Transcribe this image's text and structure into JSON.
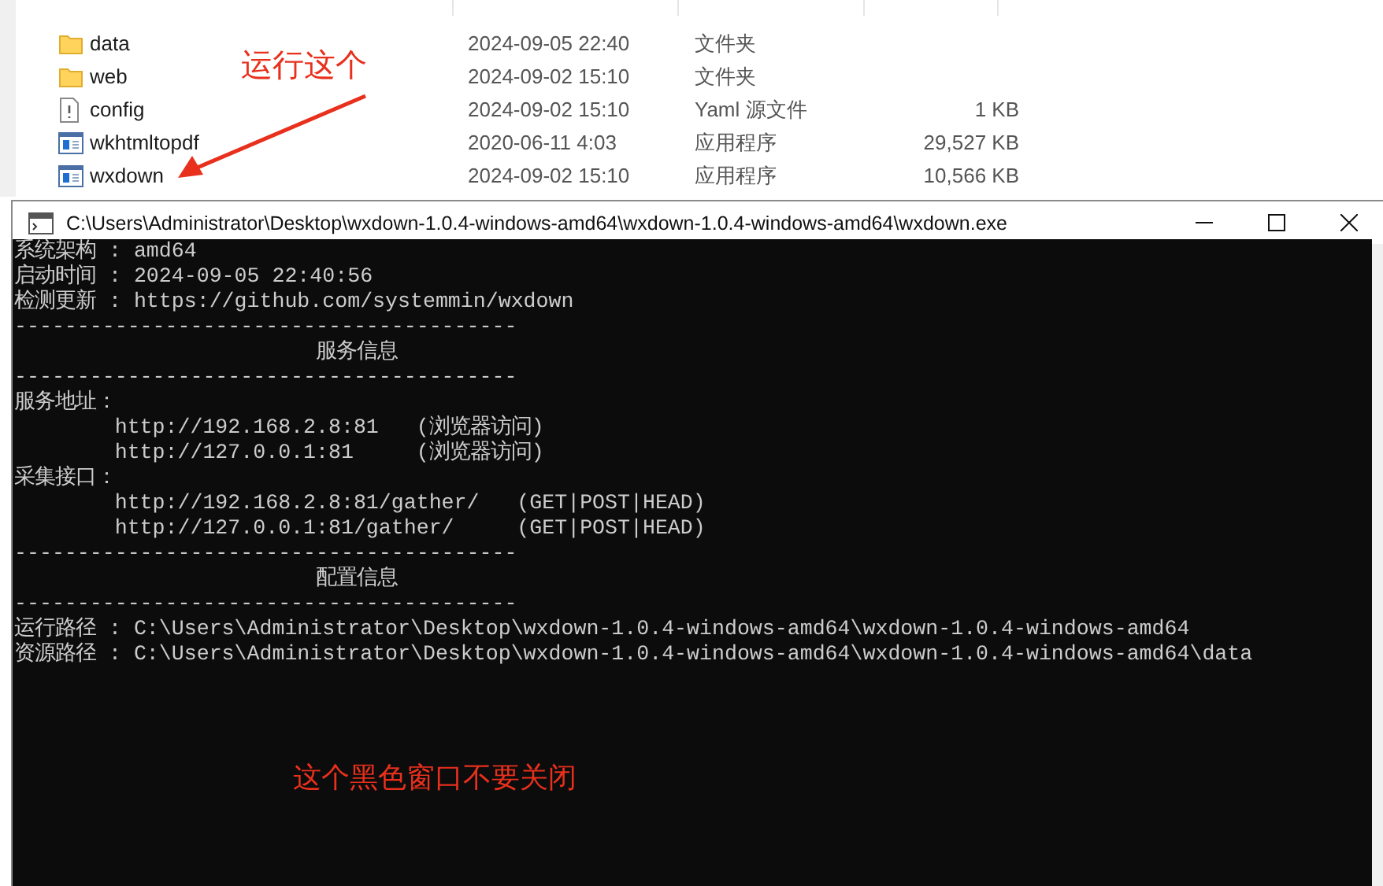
{
  "explorer": {
    "files": [
      {
        "name": "data",
        "modified": "2024-09-05 22:40",
        "type": "文件夹",
        "kind": "folder"
      },
      {
        "name": "web",
        "modified": "2024-09-02 15:10",
        "type": "文件夹",
        "kind": "folder"
      },
      {
        "name": "config",
        "modified": "2024-09-02 15:10",
        "type": "Yaml 源文件",
        "size": "1 KB",
        "kind": "yaml"
      },
      {
        "name": "wkhtmltopdf",
        "modified": "2020-06-11 4:03",
        "type": "应用程序",
        "size": "29,527 KB",
        "kind": "app"
      },
      {
        "name": "wxdown",
        "modified": "2024-09-02 15:10",
        "type": "应用程序",
        "size": "10,566 KB",
        "kind": "app"
      }
    ]
  },
  "explorer_note": "运行这个",
  "console": {
    "title": "C:\\Users\\Administrator\\Desktop\\wxdown-1.0.4-windows-amd64\\wxdown-1.0.4-windows-amd64\\wxdown.exe",
    "lines": [
      "系统架构 : amd64",
      "启动时间 : 2024-09-05 22:40:56",
      "检测更新 : https://github.com/systemmin/wxdown",
      "----------------------------------------",
      "                        服务信息",
      "----------------------------------------",
      "服务地址：",
      "        http://192.168.2.8:81   (浏览器访问)",
      "        http://127.0.0.1:81     (浏览器访问)",
      "采集接口：",
      "        http://192.168.2.8:81/gather/   (GET|POST|HEAD)",
      "        http://127.0.0.1:81/gather/     (GET|POST|HEAD)",
      "----------------------------------------",
      "                        配置信息",
      "----------------------------------------",
      "运行路径 : C:\\Users\\Administrator\\Desktop\\wxdown-1.0.4-windows-amd64\\wxdown-1.0.4-windows-amd64",
      "资源路径 : C:\\Users\\Administrator\\Desktop\\wxdown-1.0.4-windows-amd64\\wxdown-1.0.4-windows-amd64\\data"
    ]
  },
  "console_note": "这个黑色窗口不要关闭"
}
